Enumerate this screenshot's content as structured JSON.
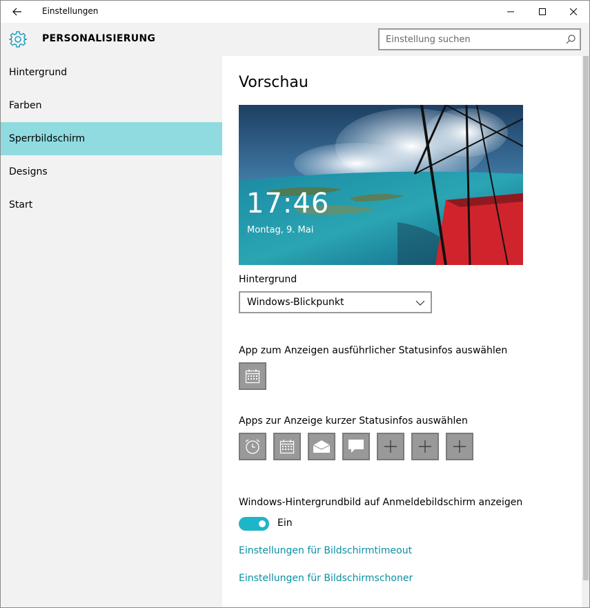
{
  "window": {
    "title": "Einstellungen"
  },
  "header": {
    "title": "PERSONALISIERUNG",
    "search_placeholder": "Einstellung suchen"
  },
  "sidebar": {
    "items": [
      {
        "label": "Hintergrund",
        "active": false
      },
      {
        "label": "Farben",
        "active": false
      },
      {
        "label": "Sperrbildschirm",
        "active": true
      },
      {
        "label": "Designs",
        "active": false
      },
      {
        "label": "Start",
        "active": false
      }
    ]
  },
  "main": {
    "preview_heading": "Vorschau",
    "preview_time": "17:46",
    "preview_date": "Montag, 9. Mai",
    "background_label": "Hintergrund",
    "background_value": "Windows-Blickpunkt",
    "detailed_status_label": "App zum Anzeigen ausführlicher Statusinfos auswählen",
    "quick_status_label": "Apps zur Anzeige kurzer Statusinfos auswählen",
    "quick_status_apps": [
      "alarm-icon",
      "calendar-icon",
      "mail-icon",
      "message-icon",
      "plus-icon",
      "plus-icon",
      "plus-icon"
    ],
    "logon_background_label": "Windows-Hintergrundbild auf Anmeldebildschirm anzeigen",
    "toggle_state": "Ein",
    "link_timeout": "Einstellungen für Bildschirmtimeout",
    "link_screensaver": "Einstellungen für Bildschirmschoner"
  },
  "colors": {
    "accent": "#1fb5c8",
    "nav_active": "#8fdbe0",
    "link": "#0a8fa3"
  }
}
